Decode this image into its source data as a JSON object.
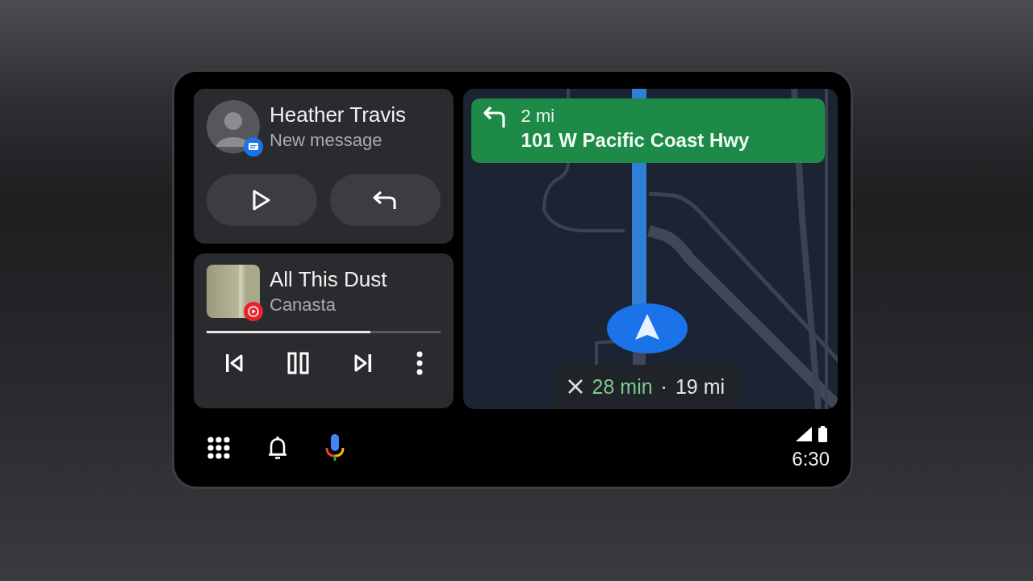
{
  "message_card": {
    "sender": "Heather Travis",
    "subtitle": "New message"
  },
  "media_card": {
    "title": "All This Dust",
    "artist": "Canasta",
    "progress": {
      "level": 0.7
    }
  },
  "navigation": {
    "distance": "2 mi",
    "street": "101 W Pacific Coast Hwy",
    "trip": {
      "duration": "28 min",
      "separator": "·",
      "distance": "19 mi"
    }
  },
  "status_bar": {
    "time": "6:30"
  }
}
